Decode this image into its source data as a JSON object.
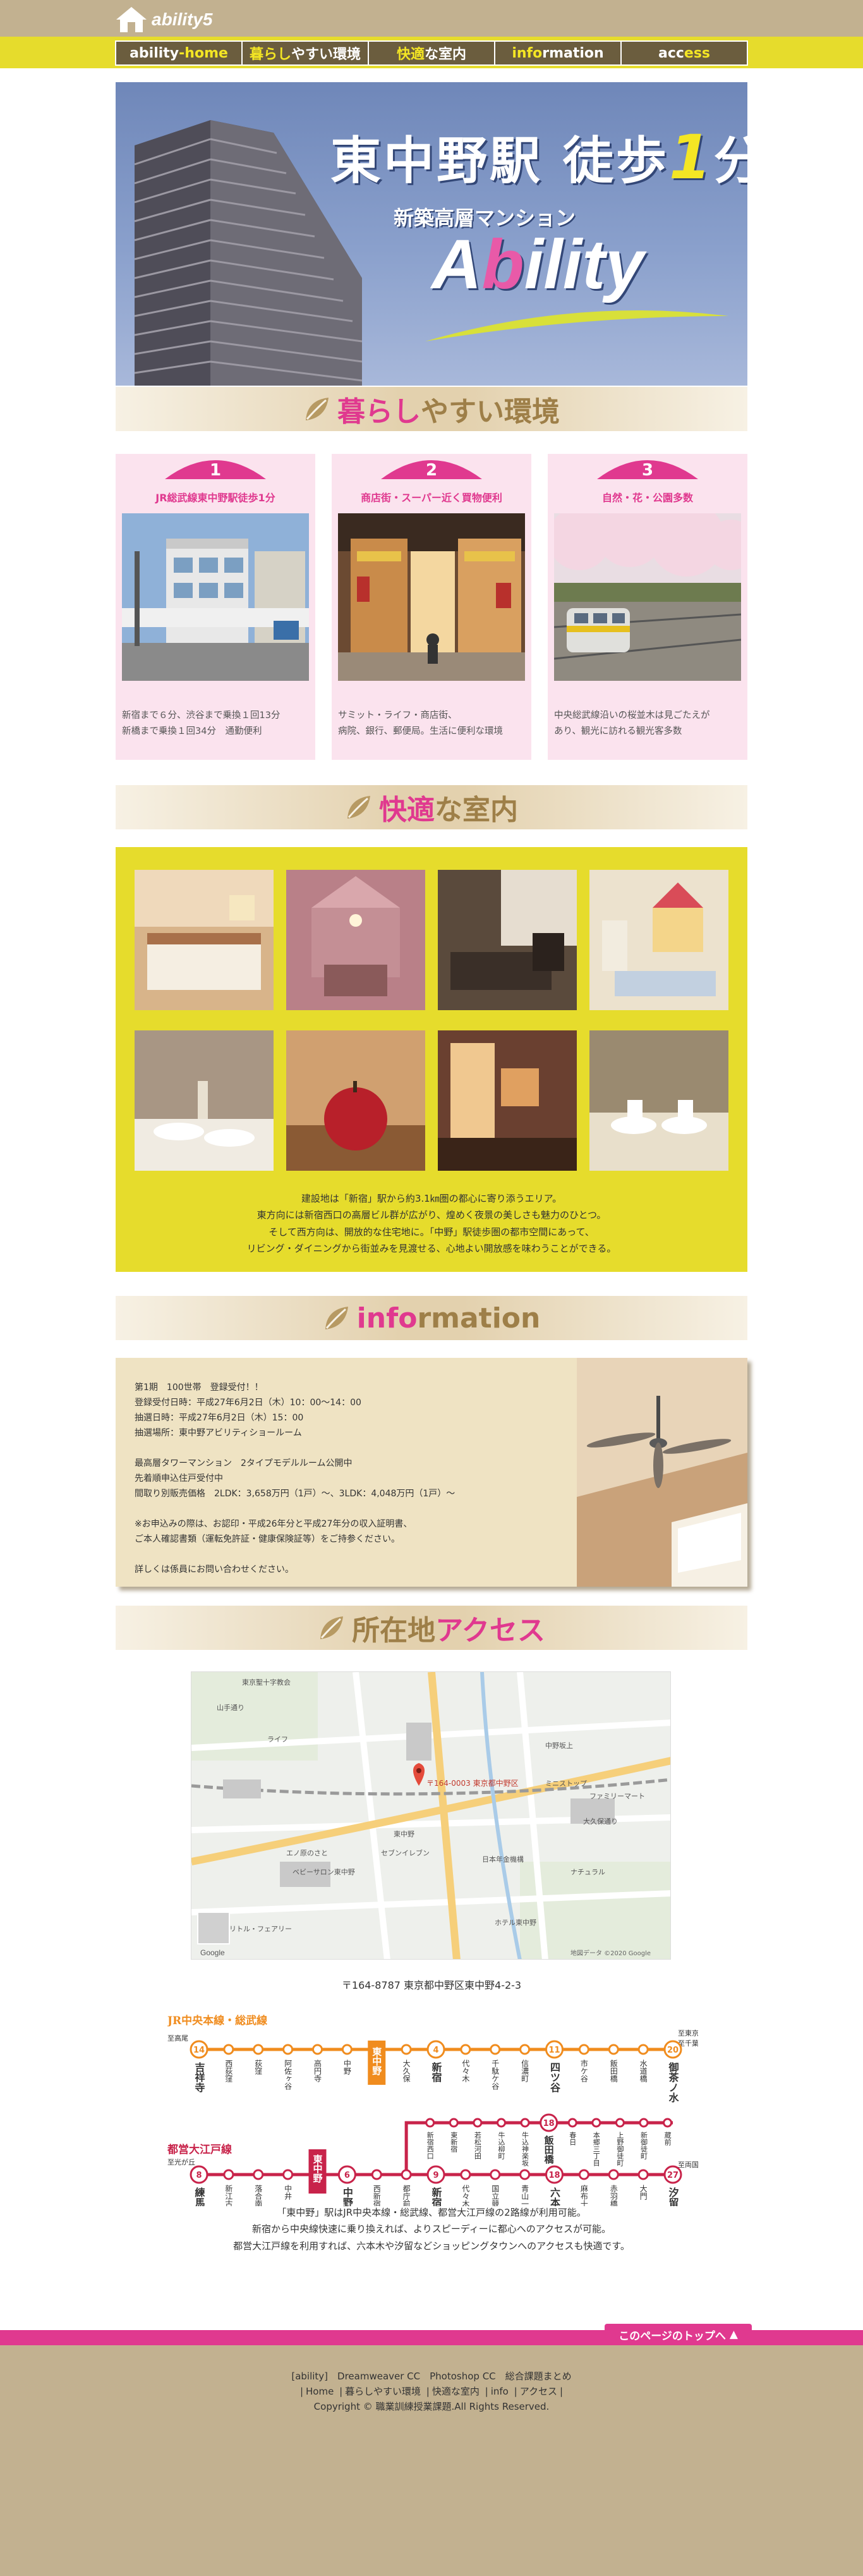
{
  "header": {
    "logo_text": "ability5",
    "nav": [
      {
        "label_a": "ability",
        "label_b": "-home",
        "label_c": ""
      },
      {
        "label_a": "暮らし",
        "label_b": "やすい環境",
        "label_c": ""
      },
      {
        "label_a": "快適",
        "label_b": "な室内",
        "label_c": ""
      },
      {
        "label_a": "info",
        "label_b": "rmation",
        "label_c": ""
      },
      {
        "label_a": "acc",
        "label_b": "ess",
        "label_c": ""
      }
    ]
  },
  "hero": {
    "title_a": "東中野駅 徒歩",
    "title_num": "1",
    "title_b": "分",
    "subtitle": "新築高層マンション",
    "brand_a": "A",
    "brand_b": "b",
    "brand_c": "ility"
  },
  "sections": {
    "living": {
      "a": "暮らし",
      "b": "やすい環境"
    },
    "interior": {
      "a": "快適",
      "b": "な室内"
    },
    "info": {
      "a": "info",
      "b": "rmation"
    },
    "access": {
      "a": "所在地",
      "b": "アクセス"
    }
  },
  "features": [
    {
      "num": "1",
      "title": "JR総武線東中野駅徒歩1分",
      "desc": "新宿まで６分、渋谷まで乗換１回13分\n新橋まで乗換１回34分　通勤便利"
    },
    {
      "num": "2",
      "title": "商店街・スーパー近く買物便利",
      "desc": "サミット・ライフ・商店街、\n病院、銀行、郵便局。生活に便利な環境"
    },
    {
      "num": "3",
      "title": "自然・花・公園多数",
      "desc": "中央総武線沿いの桜並木は見ごたえが\nあり、観光に訪れる観光客多数"
    }
  ],
  "amenity_text": [
    "建設地は「新宿」駅から約3.1㎞圏の都心に寄り添うエリア。",
    "東方向には新宿西口の高層ビル群が広がり、煌めく夜景の美しさも魅力のひとつ。",
    "そして西方向は、開放的な住宅地に。「中野」駅徒歩圏の都市空間にあって、",
    "リビング・ダイニングから街並みを見渡せる、心地よい開放感を味わうことができる。"
  ],
  "info_text": [
    "第1期　100世帯　登録受付！！",
    "登録受付日時：平成27年6月2日（木）10：00～14：00",
    "抽選日時：平成27年6月2日（木）15：00",
    "抽選場所：東中野アビリティショールーム",
    "",
    "最高層タワーマンション　2タイプモデルルーム公開中",
    "先着順申込住戸受付中",
    "間取り別販売価格　2LDK：3,658万円（1戸）～、3LDK：4,048万円（1戸）～",
    "",
    "※お申込みの際は、お認印・平成26年分と平成27年分の収入証明書、",
    "ご本人確認書類（運転免許証・健康保険証等）をご持参ください。",
    "",
    "詳しくは係員にお問い合わせください。"
  ],
  "map": {
    "pin_label": "〒164-0003 東京都中野区",
    "google": "Google",
    "credit": "地図データ ©2020 Google",
    "labels": [
      "東京聖十字教会",
      "東中野",
      "中野坂上",
      "大久保通り",
      "ライフ",
      "山手通り",
      "セブンイレブン",
      "日本年金機構",
      "ファミリーマート",
      "ミニストップ",
      "ホテル東中野",
      "ナチュラル",
      "リトル・フェアリー",
      "ベビーサロン東中野",
      "エノ原のさと"
    ]
  },
  "address": "〒164-8787 東京都中野区東中野4-2-3",
  "rail": {
    "jr_label": "JR中央本線・総武線",
    "oedo_label": "都営大江戸線",
    "jr_stations": [
      "吉祥寺",
      "西荻窪",
      "荻窪",
      "阿佐ヶ谷",
      "高円寺",
      "中野",
      "東中野",
      "大久保",
      "新宿",
      "代々木",
      "千駄ケ谷",
      "信濃町",
      "四ツ谷",
      "市ケ谷",
      "飯田橋",
      "水道橋",
      "御茶ノ水"
    ],
    "jr_nums": [
      "14",
      "4",
      "11",
      "20"
    ],
    "jr_end_a": "至東京",
    "jr_end_b": "至千葉",
    "jr_start": "至高尾",
    "oedo_stations": [
      "練馬",
      "新江古田",
      "落合南長崎",
      "中井",
      "東中野",
      "中野坂上",
      "西新宿五丁目",
      "都庁前",
      "新宿",
      "代々木",
      "国立競技場",
      "青山一丁目",
      "六本木",
      "麻布十番",
      "赤羽橋",
      "大門",
      "汐留"
    ],
    "oedo_nums": [
      "8",
      "6",
      "9",
      "18",
      "27"
    ],
    "oedo_start": "至光が丘",
    "oedo_end": "至両国",
    "loop": [
      "新宿西口",
      "東新宿",
      "若松河田",
      "牛込柳町",
      "牛込神楽坂",
      "飯田橋",
      "春日",
      "本郷三丁目",
      "上野御徒町",
      "新御徒町",
      "蔵前"
    ]
  },
  "access_text": [
    "「東中野」駅はJR中央本線・総武線、都営大江戸線の2路線が利用可能。",
    "新宿から中央線快速に乗り換えれば、よりスピーディーに都心へのアクセスが可能。",
    "都営大江戸線を利用すれば、六本木や汐留などショッピングタウンへのアクセスも快適です。"
  ],
  "footer": {
    "totop": "このページのトップへ",
    "line1": "[ability]　Dreamweaver CC　Photoshop CC　総合課題まとめ",
    "links": [
      "Home",
      "暮らしやすい環境",
      "快適な室内",
      "info",
      "アクセス"
    ],
    "copyright": "Copyright © 職業訓練授業課題.All Rights Reserved."
  }
}
